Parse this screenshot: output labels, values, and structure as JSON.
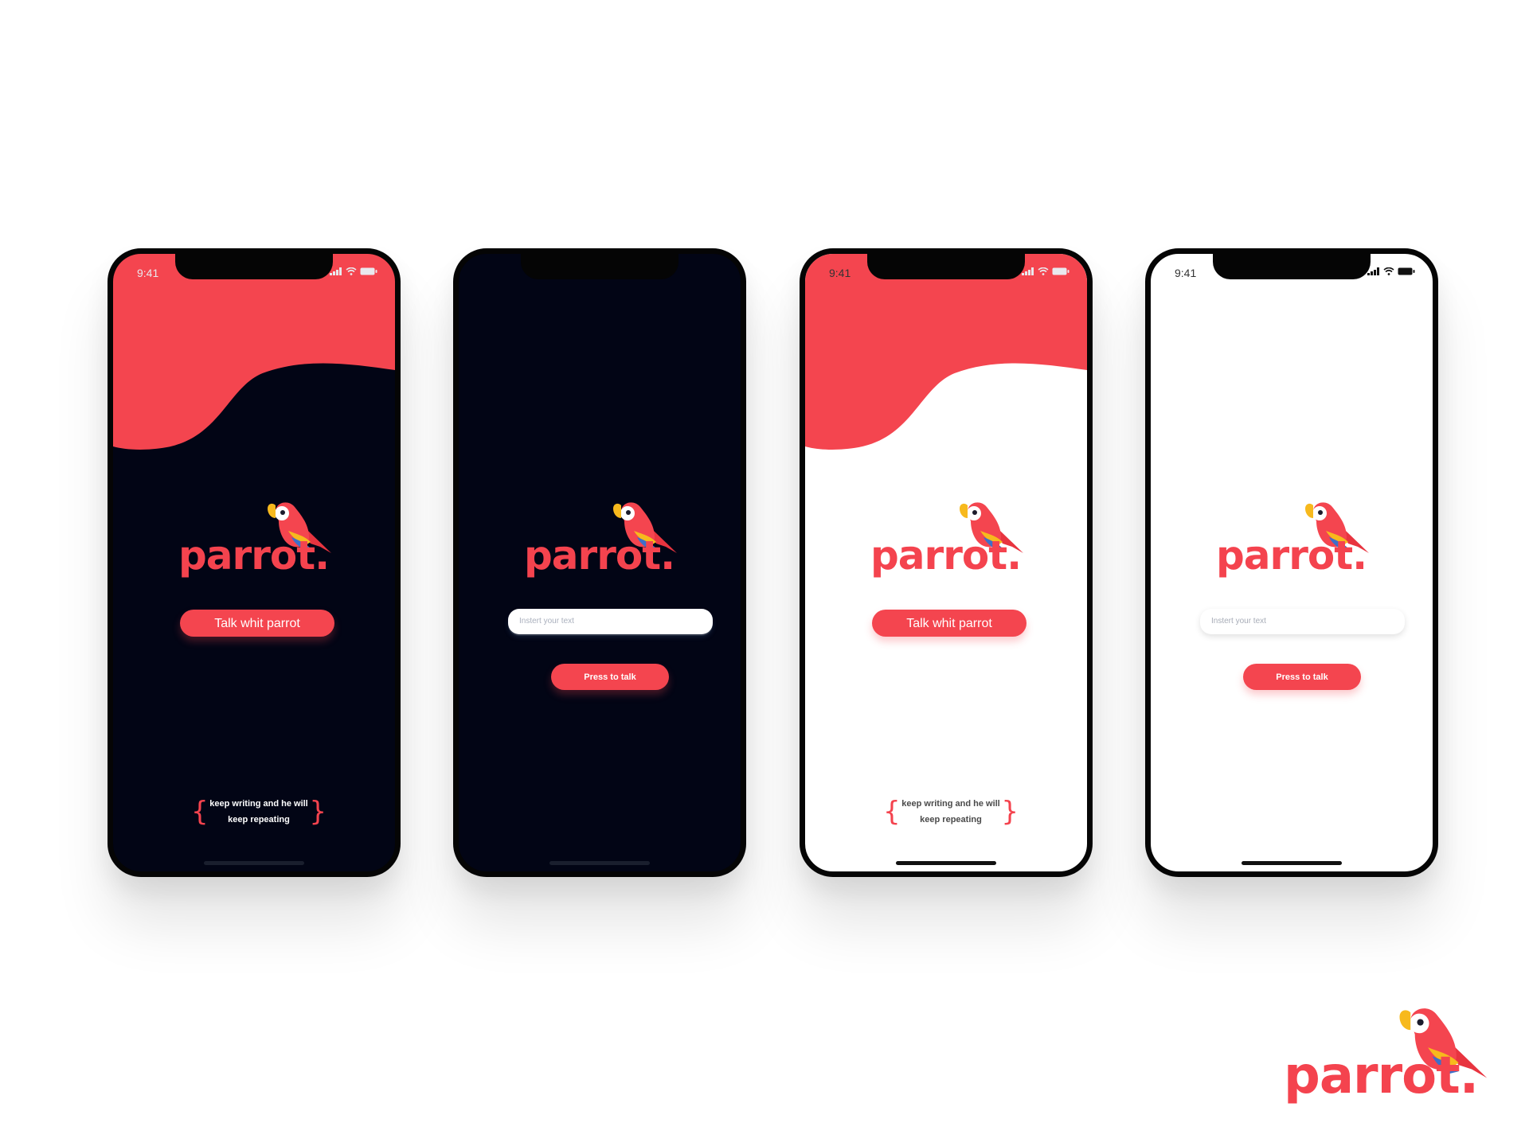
{
  "colors": {
    "accent": "#f4454f",
    "dark_bg": "#020515",
    "light_bg": "#ffffff",
    "parrot_yellow": "#f7b91d",
    "parrot_blue": "#3d6fc9",
    "frame": "#050505"
  },
  "status_bar": {
    "time": "9:41"
  },
  "brand": {
    "name": "parrot."
  },
  "screens": [
    {
      "theme": "dark",
      "type": "welcome",
      "button_label": "Talk whit parrot",
      "tagline_line1": "keep writing and he will",
      "tagline_line2": "keep repeating"
    },
    {
      "theme": "dark",
      "type": "input",
      "input_placeholder": "Instert your text",
      "button_label": "Press to talk"
    },
    {
      "theme": "light",
      "type": "welcome",
      "button_label": "Talk whit parrot",
      "tagline_line1": "keep writing and he will",
      "tagline_line2": "keep repeating"
    },
    {
      "theme": "light",
      "type": "input",
      "input_placeholder": "Instert your text",
      "button_label": "Press to talk"
    }
  ],
  "icons": [
    "signal-icon",
    "wifi-icon",
    "battery-icon",
    "parrot-icon"
  ]
}
